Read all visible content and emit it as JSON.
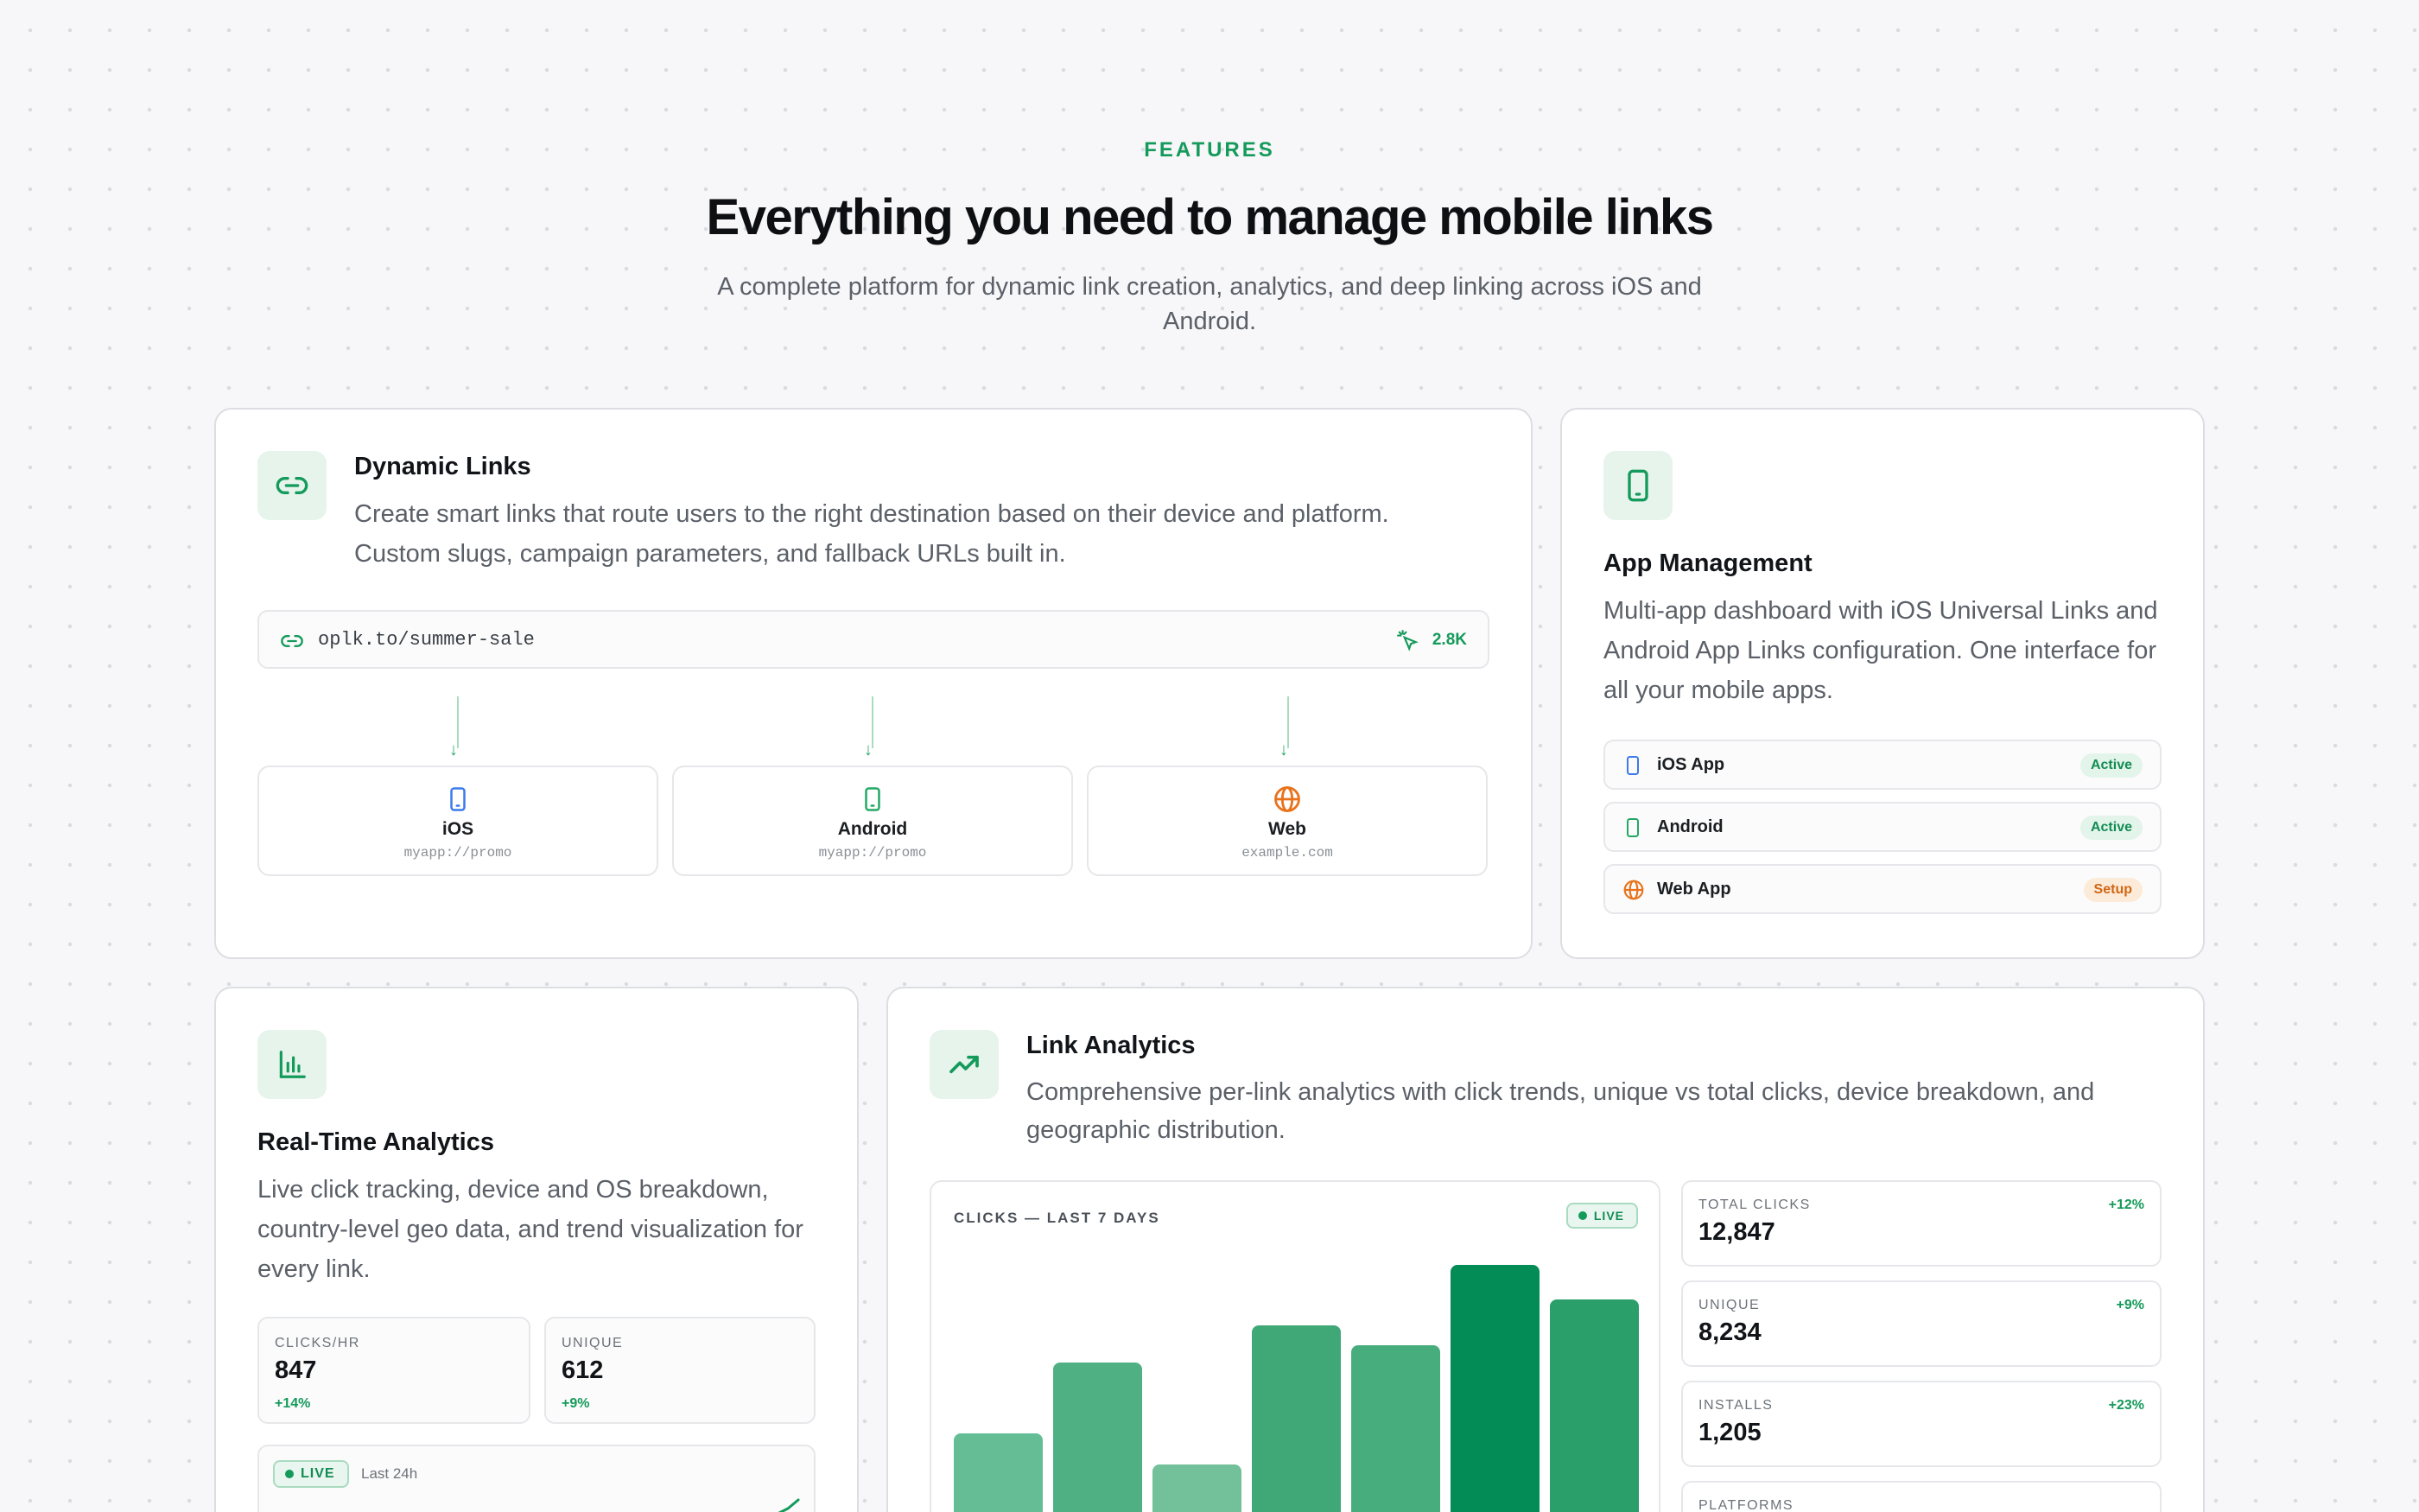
{
  "header": {
    "eyebrow": "FEATURES",
    "title": "Everything you need to manage mobile links",
    "subtitle": "A complete platform for dynamic link creation, analytics, and deep linking across iOS and Android."
  },
  "colors": {
    "accent": "#149a5a",
    "ios": "#3b7bea",
    "android": "#22a865",
    "web": "#e8731c"
  },
  "dynamic_links": {
    "icon": "link-icon",
    "title": "Dynamic Links",
    "description": "Create smart links that route users to the right destination based on their device and platform. Custom slugs, campaign parameters, and fallback URLs built in.",
    "url": "oplk.to/summer-sale",
    "clicks": "2.8K",
    "destinations": [
      {
        "name": "iOS",
        "target": "myapp://promo",
        "icon": "phone-icon"
      },
      {
        "name": "Android",
        "target": "myapp://promo",
        "icon": "phone-icon"
      },
      {
        "name": "Web",
        "target": "example.com",
        "icon": "globe-icon"
      }
    ]
  },
  "app_management": {
    "icon": "phone-icon",
    "title": "App Management",
    "description": "Multi-app dashboard with iOS Universal Links and Android App Links configuration. One interface for all your mobile apps.",
    "apps": [
      {
        "name": "iOS App",
        "status": "Active"
      },
      {
        "name": "Android",
        "status": "Active"
      },
      {
        "name": "Web App",
        "status": "Setup"
      }
    ]
  },
  "realtime": {
    "icon": "bar-chart-icon",
    "title": "Real-Time Analytics",
    "description": "Live click tracking, device and OS breakdown, country-level geo data, and trend visualization for every link.",
    "stats": [
      {
        "label": "CLICKS/HR",
        "value": "847",
        "delta": "+14%"
      },
      {
        "label": "UNIQUE",
        "value": "612",
        "delta": "+9%"
      }
    ],
    "live_label": "LIVE",
    "period": "Last 24h"
  },
  "link_analytics": {
    "icon": "trending-up-icon",
    "title": "Link Analytics",
    "description": "Comprehensive per-link analytics with click trends, unique vs total clicks, device breakdown, and geographic distribution.",
    "chart_label": "CLICKS — LAST 7 DAYS",
    "live_label": "LIVE",
    "kpis": [
      {
        "label": "TOTAL CLICKS",
        "value": "12,847",
        "delta": "+12%"
      },
      {
        "label": "UNIQUE",
        "value": "8,234",
        "delta": "+9%"
      },
      {
        "label": "INSTALLS",
        "value": "1,205",
        "delta": "+23%"
      },
      {
        "label": "PLATFORMS",
        "value": "",
        "delta": ""
      }
    ]
  },
  "chart_data": {
    "type": "bar",
    "title": "CLICKS — LAST 7 DAYS",
    "categories": [],
    "values": [
      0.33,
      0.58,
      0.22,
      0.71,
      0.64,
      0.92,
      0.8
    ],
    "value_units": "fraction of chart height (no axis printed)",
    "colors": [
      "#64bd95",
      "#4fb083",
      "#72c19b",
      "#40a877",
      "#48ad7d",
      "#038c55",
      "#2a9f69"
    ],
    "xlabel": "",
    "ylabel": "",
    "grid": false
  }
}
